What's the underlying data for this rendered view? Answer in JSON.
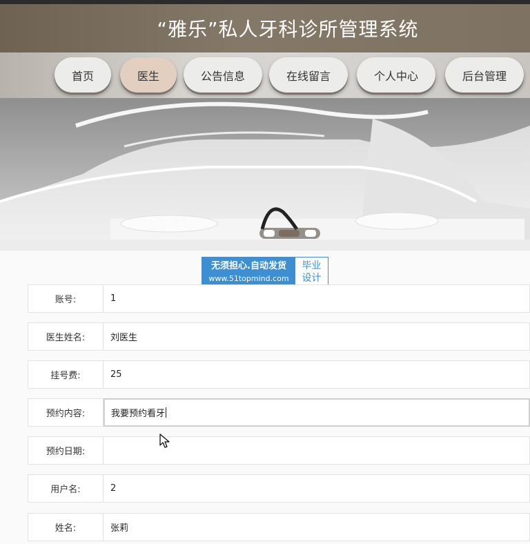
{
  "header": {
    "title": "“雅乐”私人牙科诊所管理系统"
  },
  "nav": {
    "items": [
      {
        "label": "首页"
      },
      {
        "label": "医生"
      },
      {
        "label": "公告信息"
      },
      {
        "label": "在线留言"
      },
      {
        "label": "个人中心"
      },
      {
        "label": "后台管理"
      }
    ],
    "active_index": 1
  },
  "watermark": {
    "line1": "无须担心.自动发货",
    "line2": "www.51topmind.com",
    "right1": "毕业",
    "right2": "设计"
  },
  "form": {
    "rows": [
      {
        "label": "账号:",
        "value": "1"
      },
      {
        "label": "医生姓名:",
        "value": "刘医生"
      },
      {
        "label": "挂号费:",
        "value": "25"
      },
      {
        "label": "预约内容:",
        "value": "我要预约看牙"
      },
      {
        "label": "预约日期:",
        "value": ""
      },
      {
        "label": "用户名:",
        "value": "2"
      },
      {
        "label": "姓名:",
        "value": "张莉"
      }
    ]
  },
  "colors": {
    "header_bg": "#7e7262",
    "nav_active": "#e2cfbf",
    "watermark_blue": "#3e8fd1"
  }
}
